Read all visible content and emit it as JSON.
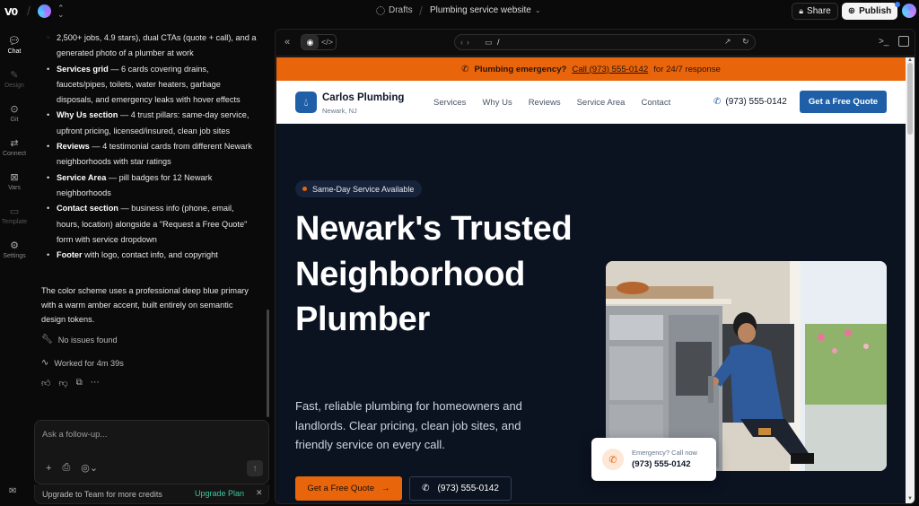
{
  "topbar": {
    "logo": "V0",
    "drafts": "Drafts",
    "project": "Plumbing service website",
    "share": "Share",
    "publish": "Publish"
  },
  "rail": [
    {
      "label": "Chat",
      "icon": "chat-icon"
    },
    {
      "label": "Design",
      "icon": "design-icon"
    },
    {
      "label": "Git",
      "icon": "git-icon"
    },
    {
      "label": "Connect",
      "icon": "connect-icon"
    },
    {
      "label": "Vars",
      "icon": "vars-icon"
    },
    {
      "label": "Template",
      "icon": "template-icon"
    },
    {
      "label": "Settings",
      "icon": "settings-icon"
    }
  ],
  "chat": {
    "intro": "2,500+ jobs, 4.9 stars), dual CTAs (quote + call), and a generated photo of a plumber at work",
    "bullets": [
      {
        "title": "Services grid",
        "text": " — 6 cards covering drains, faucets/pipes, toilets, water heaters, garbage disposals, and emergency leaks with hover effects"
      },
      {
        "title": "Why Us section",
        "text": " — 4 trust pillars: same-day service, upfront pricing, licensed/insured, clean job sites"
      },
      {
        "title": "Reviews",
        "text": " — 4 testimonial cards from different Newark neighborhoods with star ratings"
      },
      {
        "title": "Service Area",
        "text": " — pill badges for 12 Newark neighborhoods"
      },
      {
        "title": "Contact section",
        "text": " — business info (phone, email, hours, location) alongside a \"Request a Free Quote\" form with service dropdown"
      },
      {
        "title": "Footer",
        "text": " with logo, contact info, and copyright"
      }
    ],
    "summary": "The color scheme uses a professional deep blue primary with a warm amber accent, built entirely on semantic design tokens.",
    "no_issues": "No issues found",
    "worked": "Worked for 4m 39s",
    "composer_placeholder": "Ask a follow-up...",
    "upgrade_text": "Upgrade to Team for more credits",
    "upgrade_link": "Upgrade Plan"
  },
  "preview": {
    "url_path": "/"
  },
  "site": {
    "alert_label": "Plumbing emergency?",
    "alert_call": "Call (973) 555-0142",
    "alert_suffix": "for 24/7 response",
    "brand_name": "Carlos Plumbing",
    "brand_location": "Newark, NJ",
    "nav": [
      "Services",
      "Why Us",
      "Reviews",
      "Service Area",
      "Contact"
    ],
    "phone": "(973) 555-0142",
    "quote_button": "Get a Free Quote",
    "badge": "Same-Day Service Available",
    "hero_title": "Newark's Trusted Neighborhood Plumber",
    "hero_sub": "Fast, reliable plumbing for homeowners and landlords. Clear pricing, clean job sites, and friendly service on every call.",
    "cta_primary": "Get a Free Quote",
    "cta_secondary": "(973) 555-0142",
    "emergency_label": "Emergency? Call now",
    "emergency_number": "(973) 555-0142"
  },
  "colors": {
    "accent_orange": "#e8650c",
    "primary_blue": "#1f5fa8",
    "hero_bg": "#0b1220"
  }
}
